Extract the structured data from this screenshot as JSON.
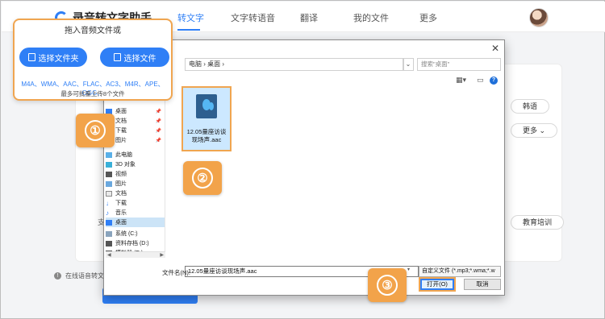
{
  "app": {
    "brand": "录音转文字助手",
    "nav": [
      "转文字",
      "文字转语音",
      "翻译",
      "我的文件",
      "更多"
    ]
  },
  "page": {
    "side_buttons": [
      "韩语",
      "更多",
      "教育培训"
    ],
    "hidden_label": "支",
    "footer_info": "在线语音转文字"
  },
  "dropzone": {
    "title": "拖入音频文件或",
    "btn_folder": "选择文件夹",
    "btn_file": "选择文件",
    "formats": "M4A、WMA、AAC、FLAC、AC3、M4R、APE、OGG、",
    "limit": "最多可批量上传8个文件"
  },
  "steps": [
    "①",
    "②",
    "③"
  ],
  "dialog": {
    "address": "电脑 › 桌面 ›",
    "search_placeholder": "搜索\"桌面\"",
    "nav_items": [
      {
        "label": "桌面",
        "icon": "desktop-icon",
        "pinned": true
      },
      {
        "label": "文档",
        "icon": "document-icon",
        "pinned": true
      },
      {
        "label": "下载",
        "icon": "download-icon",
        "pinned": true
      },
      {
        "label": "图片",
        "icon": "picture-icon",
        "pinned": true
      },
      {
        "label": "此电脑",
        "icon": "computer-icon",
        "pinned": false
      },
      {
        "label": "3D 对象",
        "icon": "3d-object-icon",
        "pinned": false
      },
      {
        "label": "视频",
        "icon": "video-icon",
        "pinned": false
      },
      {
        "label": "图片",
        "icon": "picture-icon",
        "pinned": false
      },
      {
        "label": "文档",
        "icon": "document-icon",
        "pinned": false
      },
      {
        "label": "下载",
        "icon": "download-icon",
        "pinned": false
      },
      {
        "label": "音乐",
        "icon": "music-icon",
        "pinned": false
      },
      {
        "label": "桌面",
        "icon": "desktop-icon",
        "pinned": false
      },
      {
        "label": "系统 (C:)",
        "icon": "drive-icon",
        "pinned": false
      },
      {
        "label": "资料存档 (D:)",
        "icon": "drive-icon",
        "pinned": false
      },
      {
        "label": "模拟器 (E:)",
        "icon": "drive-icon",
        "pinned": false
      }
    ],
    "file_name_display": "12.05量座访谈现场声.aac",
    "filename_label": "文件名(N):",
    "filename_value": "12.05量座访谈现场声.aac",
    "filetype": "自定义文件 (*.mp3;*.wma;*.w",
    "open_label": "打开(O)",
    "cancel_label": "取消"
  }
}
